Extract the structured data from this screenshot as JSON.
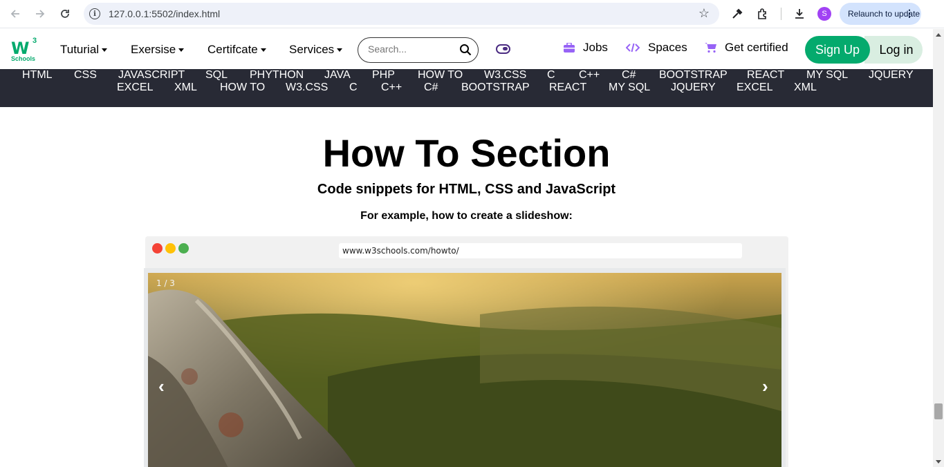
{
  "browser": {
    "url": "127.0.0.1:5502/index.html",
    "avatar_letter": "S",
    "relaunch_label": "Relaunch to update",
    "icons": [
      "back-icon",
      "forward-icon",
      "reload-icon",
      "info-icon",
      "bookmark-star-icon",
      "eyedropper-icon",
      "extensions-icon",
      "download-icon",
      "more-vert-icon"
    ]
  },
  "header": {
    "logo_main": "W",
    "logo_sup": "3",
    "logo_sub": "Schools",
    "menu": [
      {
        "label": "Tuturial"
      },
      {
        "label": "Exersise"
      },
      {
        "label": "Certifcate"
      },
      {
        "label": "Services"
      }
    ],
    "search_placeholder": "Search...",
    "links": {
      "jobs": "Jobs",
      "spaces": "Spaces",
      "certified": "Get certified"
    },
    "signup_label": "Sign Up",
    "login_label": "Log in"
  },
  "topics": {
    "row1": [
      "HTML",
      "CSS",
      "JAVASCRIPT",
      "SQL",
      "PHYTHON",
      "JAVA",
      "PHP",
      "HOW TO",
      "W3.CSS",
      "C",
      "C++",
      "C#",
      "BOOTSTRAP",
      "REACT",
      "MY SQL",
      "JQUERY"
    ],
    "row2": [
      "EXCEL",
      "XML",
      "HOW TO",
      "W3.CSS",
      "C",
      "C++",
      "C#",
      "BOOTSTRAP",
      "REACT",
      "MY SQL",
      "JQUERY",
      "EXCEL",
      "XML"
    ]
  },
  "main": {
    "title": "How To Section",
    "subtitle": "Code snippets for HTML, CSS and JavaScript",
    "example_text": "For example, how to create a slideshow:",
    "mock_url": "www.w3schools.com/howto/",
    "slide_counter": "1 / 3",
    "prev_arrow": "‹",
    "next_arrow": "›"
  },
  "colors": {
    "brand_green": "#04aa6d",
    "topics_bg": "#282a35",
    "accent_purple": "#9763f6",
    "dot_red": "#f44336",
    "dot_yellow": "#ffc107",
    "dot_green": "#4caf50"
  }
}
